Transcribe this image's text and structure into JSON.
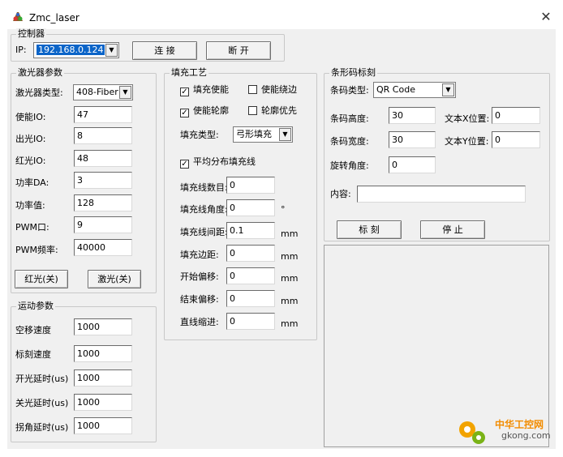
{
  "window": {
    "title": "Zmc_laser",
    "close_glyph": "✕"
  },
  "controller": {
    "title": "控制器",
    "ip_label": "IP:",
    "ip_value": "192.168.0.124",
    "connect_btn": "连 接",
    "disconnect_btn": "断 开"
  },
  "laser": {
    "title": "激光器参数",
    "type_label": "激光器类型:",
    "type_value": "408-Fiber",
    "enable_io_label": "使能IO:",
    "enable_io_value": "47",
    "out_io_label": "出光IO:",
    "out_io_value": "8",
    "red_io_label": "红光IO:",
    "red_io_value": "48",
    "power_da_label": "功率DA:",
    "power_da_value": "3",
    "power_value_label": "功率值:",
    "power_value_value": "128",
    "pwm_port_label": "PWM口:",
    "pwm_port_value": "9",
    "pwm_freq_label": "PWM频率:",
    "pwm_freq_value": "40000",
    "red_btn": "红光(关)",
    "laser_btn": "激光(关)"
  },
  "motion": {
    "title": "运动参数",
    "idle_speed_label": "空移速度",
    "idle_speed_value": "1000",
    "mark_speed_label": "标刻速度",
    "mark_speed_value": "1000",
    "on_delay_label": "开光延时(us)",
    "on_delay_value": "1000",
    "off_delay_label": "关光延时(us)",
    "off_delay_value": "1000",
    "corner_delay_label": "拐角延时(us)",
    "corner_delay_value": "1000"
  },
  "fill": {
    "title": "填充工艺",
    "cb_fill_enable": "填充使能",
    "cb_fill_enable_checked": "✓",
    "cb_edge_enable": "使能绕边",
    "cb_outline_enable": "使能轮廓",
    "cb_outline_enable_checked": "✓",
    "cb_outline_first": "轮廓优先",
    "fill_type_label": "填充类型:",
    "fill_type_value": "弓形填充",
    "cb_even_lines": "平均分布填充线",
    "cb_even_lines_checked": "✓",
    "line_count_label": "填充线数目:",
    "line_count_value": "0",
    "line_angle_label": "填充线角度:",
    "line_angle_value": "0",
    "line_angle_unit": "°",
    "line_spacing_label": "填充线间距:",
    "line_spacing_value": "0.1",
    "line_spacing_unit": "mm",
    "margin_label": "填充边距:",
    "margin_value": "0",
    "margin_unit": "mm",
    "start_offset_label": "开始偏移:",
    "start_offset_value": "0",
    "start_offset_unit": "mm",
    "end_offset_label": "结束偏移:",
    "end_offset_value": "0",
    "end_offset_unit": "mm",
    "indent_label": "直线缩进:",
    "indent_value": "0",
    "indent_unit": "mm"
  },
  "barcode": {
    "title": "条形码标刻",
    "type_label": "条码类型:",
    "type_value": "QR Code",
    "height_label": "条码高度:",
    "height_value": "30",
    "text_x_label": "文本X位置:",
    "text_x_value": "0",
    "width_label": "条码宽度:",
    "width_value": "30",
    "text_y_label": "文本Y位置:",
    "text_y_value": "0",
    "rotation_label": "旋转角度:",
    "rotation_value": "0",
    "content_label": "内容:",
    "content_value": "",
    "mark_btn": "标 刻",
    "stop_btn": "停 止"
  },
  "watermark": {
    "line1": "中华工控网",
    "line2": "gkong.com"
  },
  "colors": {
    "accent_selection": "#0a64c8",
    "watermark_orange": "#f28c00"
  },
  "icons": {
    "app": "laser-app-icon",
    "close": "close-icon",
    "dropdown": "chevron-down-icon"
  }
}
